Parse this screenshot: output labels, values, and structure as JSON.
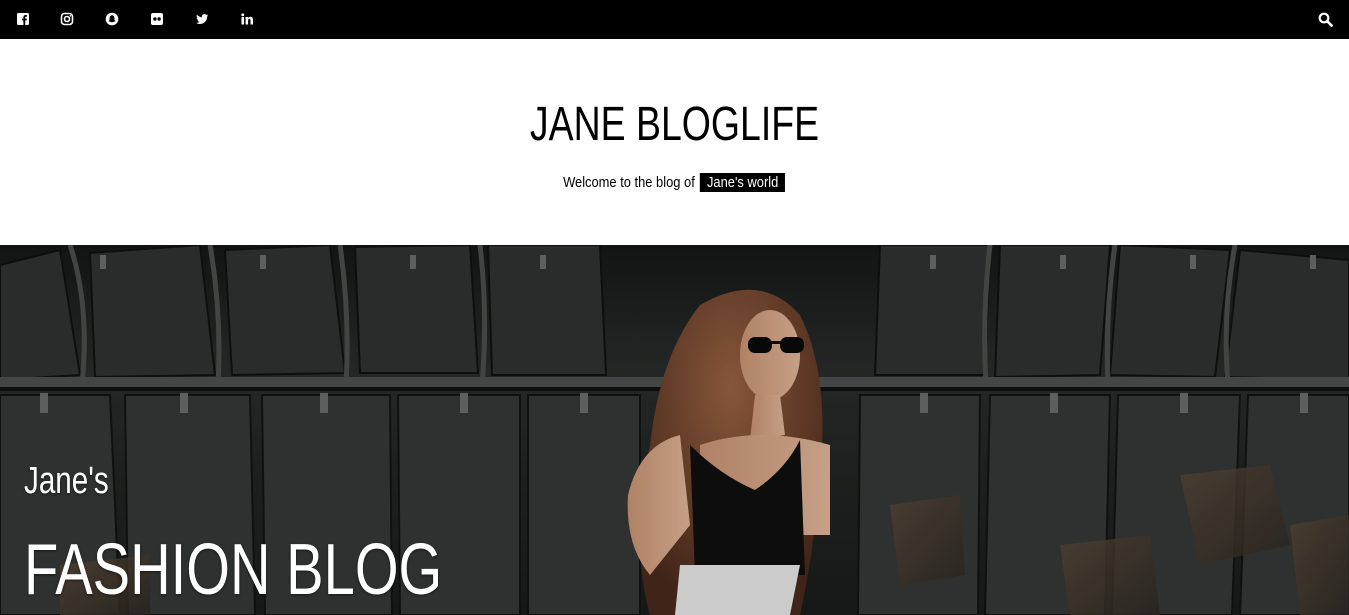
{
  "topbar": {
    "social_icons": [
      "facebook-icon",
      "instagram-icon",
      "snapchat-icon",
      "flickr-icon",
      "twitter-icon",
      "linkedin-icon"
    ],
    "search_icon": "search-icon",
    "background": "#000000"
  },
  "header": {
    "title": "JANE BLOGLIFE",
    "tagline_prefix": "Welcome to the blog of",
    "tagline_highlight": "Jane's world"
  },
  "hero": {
    "subtitle": "Jane's",
    "title": "FASHION BLOG"
  }
}
